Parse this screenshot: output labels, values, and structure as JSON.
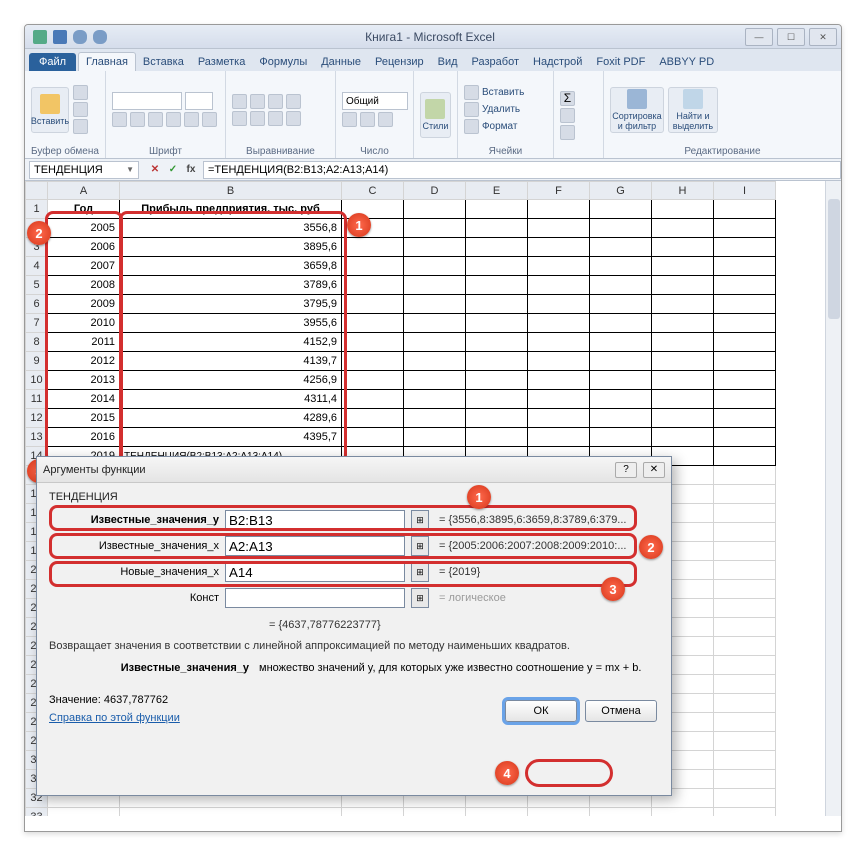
{
  "window": {
    "title": "Книга1 - Microsoft Excel",
    "min": "—",
    "max": "☐",
    "close": "✕"
  },
  "tabs": {
    "file": "Файл",
    "items": [
      "Главная",
      "Вставка",
      "Разметка",
      "Формулы",
      "Данные",
      "Рецензир",
      "Вид",
      "Разработ",
      "Надстрой",
      "Foxit PDF",
      "ABBYY PD"
    ]
  },
  "ribbon": {
    "clipboard": {
      "paste": "Вставить",
      "label": "Буфер обмена"
    },
    "font": {
      "label": "Шрифт"
    },
    "alignment": {
      "label": "Выравнивание"
    },
    "number": {
      "format": "Общий",
      "label": "Число"
    },
    "styles": {
      "btn": "Стили",
      "label": ""
    },
    "cells": {
      "insert": "Вставить",
      "delete": "Удалить",
      "format": "Формат",
      "label": "Ячейки"
    },
    "editing": {
      "sort": "Сортировка\nи фильтр",
      "find": "Найти и\nвыделить",
      "label": "Редактирование"
    }
  },
  "formula_bar": {
    "name": "ТЕНДЕНЦИЯ",
    "fx": "fx",
    "formula": "=ТЕНДЕНЦИЯ(B2:B13;A2:A13;A14)"
  },
  "grid": {
    "columns": [
      "A",
      "B",
      "C",
      "D",
      "E",
      "F",
      "G",
      "H",
      "I"
    ],
    "header_row": {
      "a": "Год",
      "b": "Прибыль предприятия, тыс. руб"
    },
    "rows": [
      {
        "n": "2",
        "a": "2005",
        "b": "3556,8"
      },
      {
        "n": "3",
        "a": "2006",
        "b": "3895,6"
      },
      {
        "n": "4",
        "a": "2007",
        "b": "3659,8"
      },
      {
        "n": "5",
        "a": "2008",
        "b": "3789,6"
      },
      {
        "n": "6",
        "a": "2009",
        "b": "3795,9"
      },
      {
        "n": "7",
        "a": "2010",
        "b": "3955,6"
      },
      {
        "n": "8",
        "a": "2011",
        "b": "4152,9"
      },
      {
        "n": "9",
        "a": "2012",
        "b": "4139,7"
      },
      {
        "n": "10",
        "a": "2013",
        "b": "4256,9"
      },
      {
        "n": "11",
        "a": "2014",
        "b": "4311,4"
      },
      {
        "n": "12",
        "a": "2015",
        "b": "4289,6"
      },
      {
        "n": "13",
        "a": "2016",
        "b": "4395,7"
      }
    ],
    "row14": {
      "n": "14",
      "a": "2019",
      "b": "ТЕНДЕНЦИЯ(B2:B13;A2:A13;A14)"
    }
  },
  "dialog": {
    "title": "Аргументы функции",
    "help": "?",
    "close": "✕",
    "fn": "ТЕНДЕНЦИЯ",
    "args": [
      {
        "label": "Известные_значения_y",
        "bold": true,
        "value": "B2:B13",
        "result": "= {3556,8:3895,6:3659,8:3789,6:379..."
      },
      {
        "label": "Известные_значения_x",
        "bold": false,
        "value": "A2:A13",
        "result": "= {2005:2006:2007:2008:2009:2010:..."
      },
      {
        "label": "Новые_значения_x",
        "bold": false,
        "value": "A14",
        "result": "= {2019}"
      },
      {
        "label": "Конст",
        "bold": false,
        "value": "",
        "result": "= логическое"
      }
    ],
    "fn_result": "= {4637,78776223777}",
    "description": "Возвращает значения в соответствии с линейной аппроксимацией по методу наименьших квадратов.",
    "param_label": "Известные_значения_y",
    "param_desc": "множество значений y, для которых уже известно соотношение y = mx + b.",
    "value_line": "Значение:  4637,787762",
    "help_link": "Справка по этой функции",
    "ok": "ОК",
    "cancel": "Отмена"
  },
  "callouts": {
    "grid": {
      "c1": "1",
      "c2": "2",
      "c3": "3"
    },
    "dlg": {
      "c1": "1",
      "c2": "2",
      "c3": "3",
      "c4": "4"
    }
  }
}
